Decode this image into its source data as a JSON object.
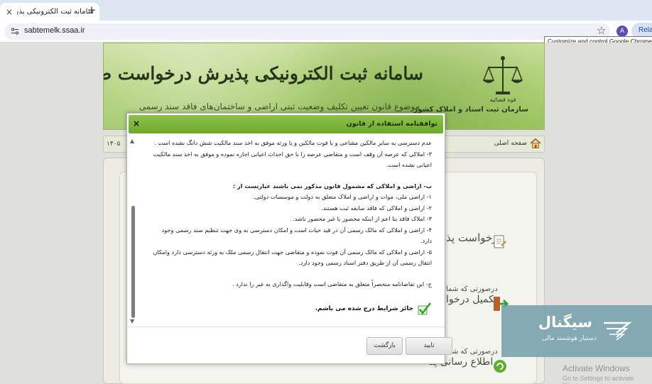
{
  "browser": {
    "tab_title": "سامانه ثبت الکترونیکی پذیرش",
    "tab_close": "×",
    "new_tab": "+",
    "url": "sabtemelk.ssaa.ir",
    "avatar_letter": "A",
    "relaunch_label": "Relau",
    "tooltip": "Customize and control Google Chrome."
  },
  "banner": {
    "title": "سامانه ثبت الکترونیکی پذیرش درخواست صدور سند مالکیت",
    "subtitle": "موضوع قانون تعیین تکلیف وضعیت ثبتی اراضی و ساختمان‌های فاقد سند رسمی",
    "org_top": "قوه قضائیه",
    "org_name": "سازمان ثبت اسناد و املاک کشور"
  },
  "breadcrumb": {
    "home_label": "صفحه اصلی",
    "date_text": "۱۴۰۵"
  },
  "background_items": {
    "item1": "درخواست پذ",
    "item2_line1": "درصورتی که شما",
    "item2_line2": "تکمیل درخوا",
    "item3_line1": "درصورتی که شما",
    "item3_line2": "اطلاع رسانی پذ"
  },
  "modal": {
    "title": "توافقنامه استفاده از قانون",
    "close": "×",
    "lines": [
      "عدم دسترسی به سایر مالکین مشاعی و یا فوت مالکین و یا ورثه موفق به اخذ سند مالکیت شش دانگ نشده است .",
      "۳- املاکی که عرصه آن وقف است و متقاضی عرصه را با حق احداث اعیانی اجاره نموده و موفق به اخذ سند مالکیت",
      "اعیانی نشده است."
    ],
    "section_b_title": "ب- اراضی و املاکی که مشمول قانون مذکور نمی باشند عبارتست از :",
    "section_b_items": [
      "۱- اراضی ملی، موات و اراضی و املاک متعلق به دولت و موسسات دولتی.",
      "۲- اراضی و املاکی که فاقد سابقه ثبت هستند.",
      "۳- املاک فاقد بنا اعم از اینکه محصور یا غیر محصور باشد.",
      "۴- اراضی و املاکی که مالک رسمی آن در قید حیات است و امکان دسترسی به وی جهت تنظیم سند رسمی وجود",
      "دارد.",
      "۵- اراضی و املاکی که مالک رسمی آن فوت نموده و متقاضی جهت انتقال رسمی ملک به ورثه دسترسی دارد وامکان",
      "انتقال رسمی آن از طریق دفتر اسناد رسمی وجود دارد."
    ],
    "section_c": "ج- این تقاضانامه منحصراً متعلق به متقاضی است وقابلیت واگذاری به غیر را ندارد .",
    "agree_label": "حائز شرایط درج شده می باشم.",
    "confirm_button": "تایید",
    "back_button": "بازگشت"
  },
  "overlay": {
    "brand": "سیگنال",
    "brand_sub": "دستیار هوشمند مالی",
    "activate_line1": "Activate Windows",
    "activate_line2": "Go to Settings to activate Windows."
  },
  "colors": {
    "header_green": "#7db43a",
    "banner_green": "#b3d37c",
    "overlay_teal": "#78a0ac"
  }
}
